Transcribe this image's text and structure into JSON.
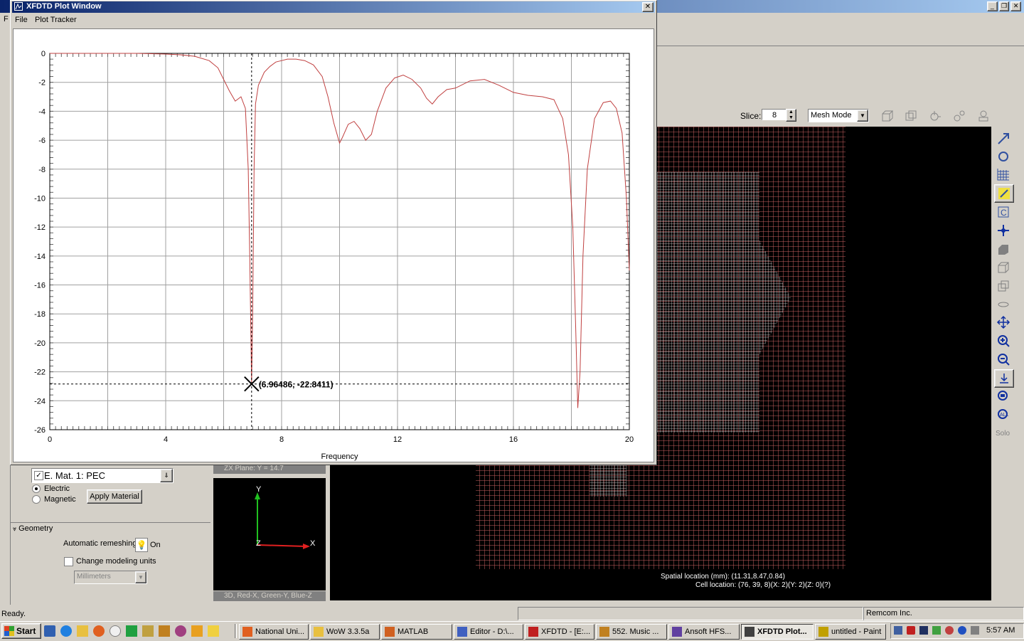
{
  "main_window": {
    "menu_initial": "F",
    "status_ready": "Ready.",
    "status_company": "Remcom Inc.",
    "slice_label": "Slice:",
    "slice_value": "8",
    "mode_select": "Mesh Mode",
    "solo_label": "Solo",
    "spatial_location": "Spatial location (mm): (11.31,8.47,0.84)",
    "cell_location": "Cell location: (76, 39, 8)(X: 2)(Y: 2)(Z: 0)(?)",
    "zx_plane_label": "ZX Plane: Y = 14.7",
    "axes_caption": "3D, Red-X, Green-Y, Blue-Z",
    "axis_x": "X",
    "axis_y": "Y",
    "axis_z": "Z"
  },
  "left_panel": {
    "material_select": "E. Mat. 1: PEC",
    "radio_electric": "Electric",
    "radio_magnetic": "Magnetic",
    "apply_button": "Apply Material",
    "geometry_header": "Geometry",
    "auto_remesh_label": "Automatic remeshing",
    "auto_remesh_state": "On",
    "change_units_label": "Change modeling units",
    "units_select": "Millimeters"
  },
  "plot_window": {
    "title": "XFDTD Plot Window",
    "menu": [
      "File",
      "Plot Tracker"
    ],
    "tracker_readout": "(6.96486, -22.8411)",
    "close_label": "✕"
  },
  "chart_data": {
    "type": "line",
    "title": "",
    "xlabel": "Frequency",
    "ylabel": "",
    "xlim": [
      0,
      20
    ],
    "ylim": [
      -26,
      0
    ],
    "x_ticks": [
      0,
      4,
      8,
      12,
      16,
      20
    ],
    "y_ticks": [
      0,
      -2,
      -4,
      -6,
      -8,
      -10,
      -12,
      -14,
      -16,
      -18,
      -20,
      -22,
      -24,
      -26
    ],
    "grid": true,
    "series": [
      {
        "color": "#c04040",
        "x": [
          0,
          1,
          2,
          3,
          4,
          4.5,
          5,
          5.5,
          5.8,
          6.0,
          6.2,
          6.4,
          6.6,
          6.75,
          6.85,
          6.9,
          6.965,
          7.0,
          7.05,
          7.1,
          7.2,
          7.4,
          7.6,
          7.8,
          8.0,
          8.2,
          8.5,
          8.8,
          9.1,
          9.4,
          9.6,
          9.8,
          10.0,
          10.1,
          10.3,
          10.5,
          10.7,
          10.9,
          11.1,
          11.3,
          11.6,
          11.9,
          12.2,
          12.5,
          12.8,
          13.0,
          13.2,
          13.4,
          13.7,
          14.0,
          14.5,
          15.0,
          15.5,
          16.0,
          16.5,
          17.0,
          17.4,
          17.7,
          17.9,
          18.05,
          18.15,
          18.22,
          18.3,
          18.4,
          18.55,
          18.8,
          19.1,
          19.35,
          19.55,
          19.75,
          19.9,
          20.0
        ],
        "y": [
          0,
          0,
          0,
          0,
          -0.05,
          -0.1,
          -0.2,
          -0.5,
          -1.0,
          -1.8,
          -2.6,
          -3.3,
          -3.0,
          -3.8,
          -8.0,
          -14.0,
          -22.8,
          -18.0,
          -8.0,
          -3.5,
          -2.2,
          -1.3,
          -0.9,
          -0.6,
          -0.5,
          -0.4,
          -0.4,
          -0.5,
          -0.8,
          -1.6,
          -3.0,
          -4.8,
          -6.2,
          -5.8,
          -4.9,
          -4.7,
          -5.2,
          -6.0,
          -5.6,
          -4.0,
          -2.4,
          -1.7,
          -1.5,
          -1.8,
          -2.4,
          -3.1,
          -3.5,
          -3.0,
          -2.5,
          -2.4,
          -1.9,
          -1.8,
          -2.2,
          -2.7,
          -2.9,
          -3.0,
          -3.2,
          -4.5,
          -7.0,
          -12.0,
          -19.0,
          -24.5,
          -22.0,
          -14.0,
          -8.0,
          -4.5,
          -3.4,
          -3.3,
          -3.8,
          -5.5,
          -10.0,
          -15.0
        ]
      }
    ],
    "tracker_point": {
      "x": 6.96486,
      "y": -22.8411
    }
  },
  "taskbar": {
    "start": "Start",
    "time": "5:57 AM",
    "tasks": [
      {
        "label": "National Uni...",
        "color": "#e06020"
      },
      {
        "label": "WoW 3.3.5a",
        "color": "#e8c040"
      },
      {
        "label": "MATLAB",
        "color": "#d06020"
      },
      {
        "label": "Editor - D:\\...",
        "color": "#4060c0"
      },
      {
        "label": "XFDTD - [E:...",
        "color": "#c02020"
      },
      {
        "label": "552. Music ...",
        "color": "#c08020"
      },
      {
        "label": "Ansoft HFS...",
        "color": "#6040a0"
      },
      {
        "label": "XFDTD Plot...",
        "color": "#404040"
      },
      {
        "label": "untitled - Paint",
        "color": "#c0a000"
      }
    ]
  }
}
